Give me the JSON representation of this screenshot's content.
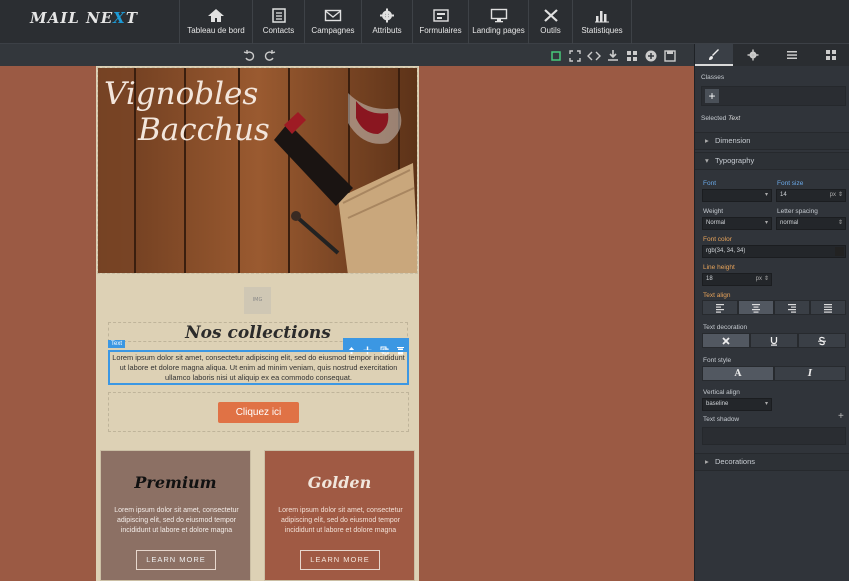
{
  "app": {
    "logo_left": "MAIL NE",
    "logo_x": "X",
    "logo_right": "T"
  },
  "nav": [
    "Tableau de bord",
    "Contacts",
    "Campagnes",
    "Attributs",
    "Formulaires",
    "Landing pages",
    "Outils",
    "Statistiques"
  ],
  "email": {
    "hero_title_line1": "Vignobles",
    "hero_title_line2": "Bacchus",
    "placeholder": "IMG",
    "section_title": "Nos collections",
    "text_badge": "Text",
    "body_text": "Lorem ipsum dolor sit amet, consectetur adipiscing elit, sed do eiusmod tempor incididunt ut labore et dolore magna aliqua. Ut enim ad minim veniam, quis nostrud exercitation ullamco laboris nisi ut aliquip ex ea commodo consequat.",
    "cta": "Cliquez ici",
    "cards": [
      {
        "title": "Premium",
        "text": "Lorem ipsum dolor sit amet, consectetur adipiscing elit, sed do eiusmod tempor incididunt ut labore et dolore magna",
        "button": "LEARN MORE"
      },
      {
        "title": "Golden",
        "text": "Lorem ipsum dolor sit amet, consectetur adipiscing elit, sed do eiusmod tempor incididunt ut labore et dolore magna",
        "button": "LEARN MORE"
      }
    ]
  },
  "panel": {
    "classes_label": "Classes",
    "selected_label": "Selected",
    "selected_value": "Text",
    "dimension": "Dimension",
    "typography": "Typography",
    "font_label": "Font",
    "font_size_label": "Font size",
    "font_size_value": "14",
    "font_size_unit": "px",
    "weight_label": "Weight",
    "weight_value": "Normal",
    "letter_spacing_label": "Letter spacing",
    "letter_spacing_value": "normal",
    "font_color_label": "Font color",
    "font_color_value": "rgb(34, 34, 34)",
    "line_height_label": "Line height",
    "line_height_value": "18",
    "line_height_unit": "px",
    "text_align_label": "Text align",
    "text_decoration_label": "Text decoration",
    "font_style_label": "Font style",
    "vertical_align_label": "Vertical align",
    "vertical_align_value": "baseline",
    "text_shadow_label": "Text shadow",
    "decorations": "Decorations"
  }
}
